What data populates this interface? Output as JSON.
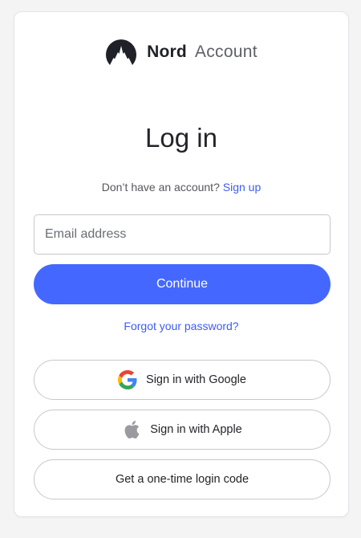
{
  "header": {
    "brand": "Nord",
    "product": "Account"
  },
  "page_title": "Log in",
  "signup": {
    "prompt": "Don’t have an account?",
    "link_label": "Sign up"
  },
  "email_field": {
    "placeholder": "Email address",
    "value": ""
  },
  "continue_label": "Continue",
  "forgot_label": "Forgot your password?",
  "sso": {
    "google_label": "Sign in with Google",
    "google_icon": "google-logo-icon",
    "apple_label": "Sign in with Apple",
    "apple_icon": "apple-logo-icon",
    "code_label": "Get a one-time login code"
  },
  "colors": {
    "accent": "#4468ff",
    "link": "#3d5cf5",
    "background": "#f4f4f5",
    "card": "#ffffff",
    "text": "#232429"
  }
}
